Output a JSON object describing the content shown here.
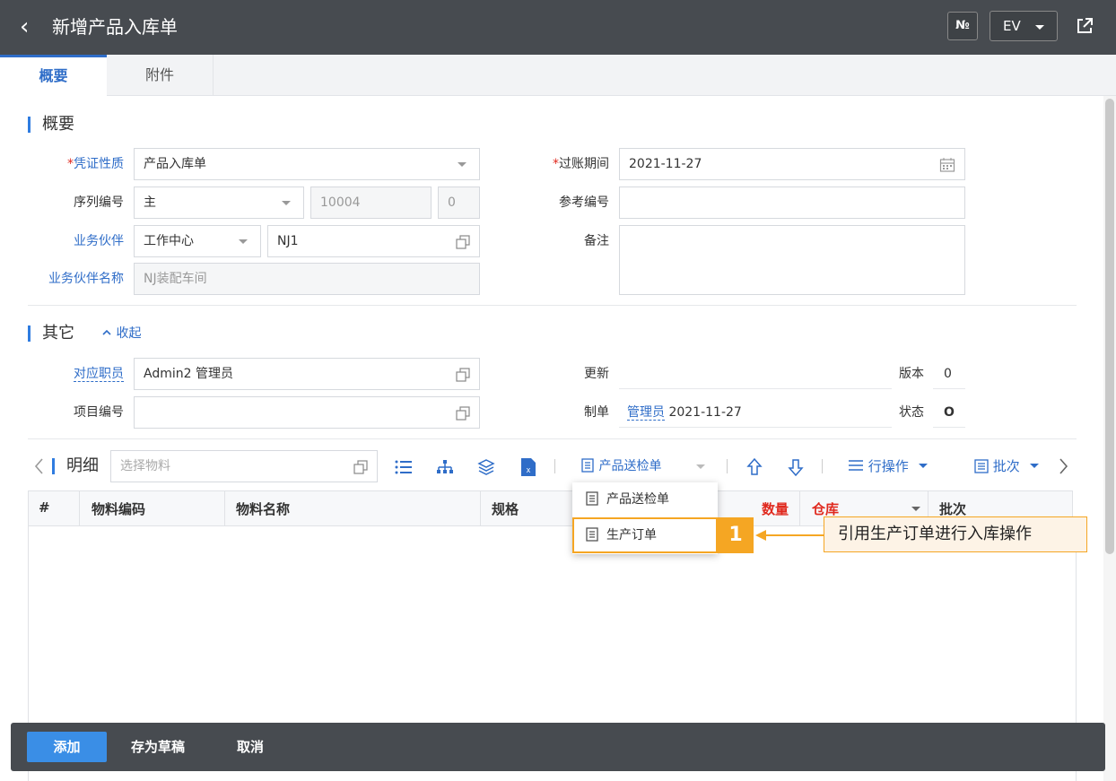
{
  "header": {
    "back": "‹",
    "title": "新增产品入库单",
    "no_label": "№",
    "lang": "EV"
  },
  "tabs": [
    "概要",
    "附件"
  ],
  "overview": {
    "section_title": "概要",
    "voucher_type_label": "凭证性质",
    "voucher_type_value": "产品入库单",
    "post_period_label": "过账期间",
    "post_period_value": "2021-11-27",
    "serial_label": "序列编号",
    "serial_value": "主",
    "serial_number": "10004",
    "serial_suffix": "0",
    "ref_label": "参考编号",
    "partner_label": "业务伙伴",
    "partner_type": "工作中心",
    "partner_value": "NJ1",
    "remark_label": "备注",
    "partner_name_label": "业务伙伴名称",
    "partner_name_value": "NJ装配车间"
  },
  "other": {
    "section_title": "其它",
    "collapse": "收起",
    "employee_label": "对应职员",
    "employee_value": "Admin2 管理员",
    "update_label": "更新",
    "version_label": "版本",
    "version_value": "0",
    "project_label": "项目编号",
    "maker_label": "制单",
    "maker_user": "管理员",
    "maker_date": "2021-11-27",
    "status_label": "状态",
    "status_value": "O"
  },
  "detail": {
    "title": "明细",
    "select_placeholder": "选择物料",
    "inspection_btn": "产品送检单",
    "row_ops": "行操作",
    "batch": "批次",
    "columns": [
      "#",
      "物料编码",
      "物料名称",
      "规格",
      "数量",
      "仓库",
      "批次"
    ]
  },
  "dropdown": {
    "items": [
      "产品送检单",
      "生产订单"
    ]
  },
  "callout": {
    "number": "1",
    "text": "引用生产订单进行入库操作"
  },
  "footer": {
    "add": "添加",
    "draft": "存为草稿",
    "cancel": "取消"
  },
  "colors": {
    "header": "#474b50",
    "accent": "#2f6dc8",
    "primary_btn": "#3a8ee6",
    "callout": "#f5a623"
  }
}
